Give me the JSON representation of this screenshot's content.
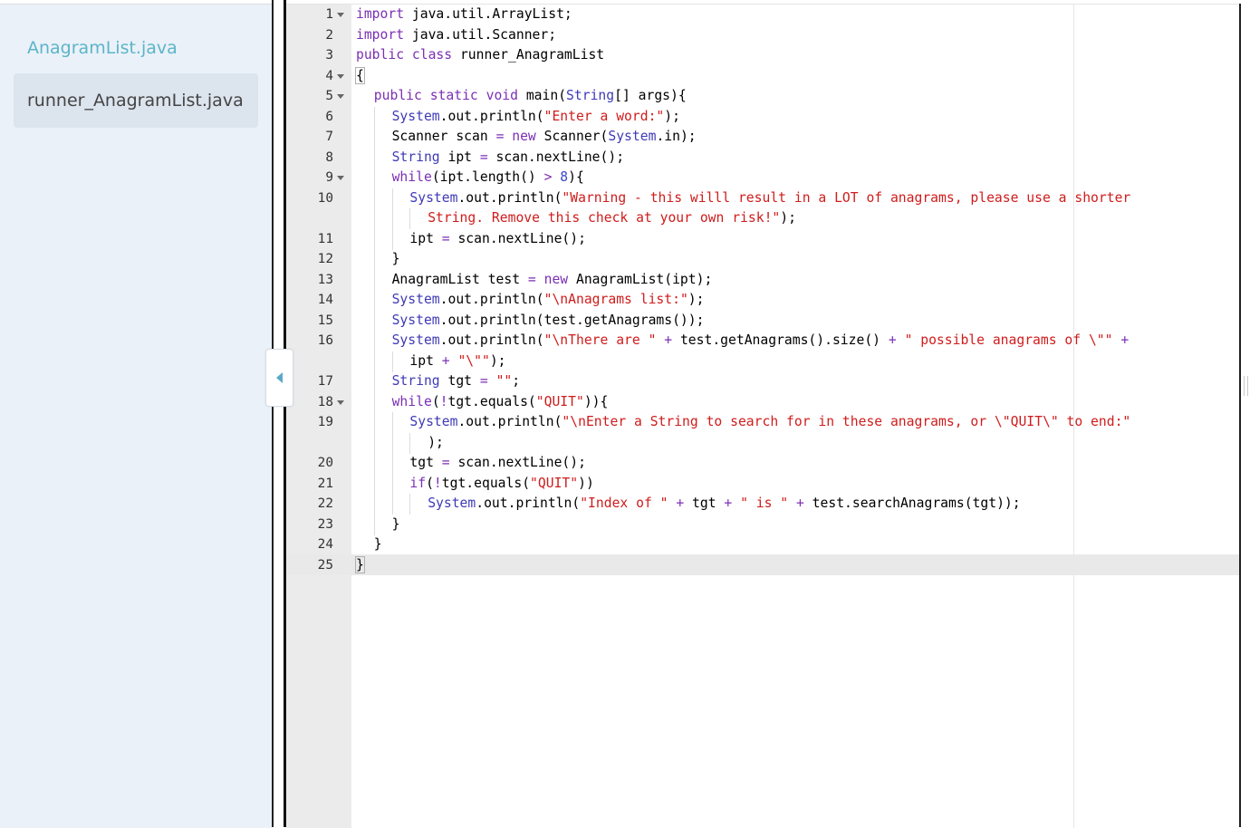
{
  "sidebar": {
    "files": [
      {
        "label": "AnagramList.java"
      },
      {
        "label": "runner_AnagramList.java"
      }
    ]
  },
  "editor": {
    "lines": [
      {
        "num": "1",
        "fold": true,
        "indent": 0,
        "parts": [
          [
            "k",
            "import"
          ],
          [
            "p",
            " java.util.ArrayList;"
          ]
        ]
      },
      {
        "num": "2",
        "indent": 0,
        "parts": [
          [
            "k",
            "import"
          ],
          [
            "p",
            " java.util.Scanner;"
          ]
        ]
      },
      {
        "num": "3",
        "indent": 0,
        "parts": [
          [
            "k",
            "public"
          ],
          [
            "p",
            " "
          ],
          [
            "k",
            "class"
          ],
          [
            "p",
            " runner_AnagramList"
          ]
        ]
      },
      {
        "num": "4",
        "fold": true,
        "indent": 0,
        "parts": [
          [
            "b",
            "{"
          ]
        ]
      },
      {
        "num": "5",
        "fold": true,
        "indent": 1,
        "parts": [
          [
            "k",
            "public"
          ],
          [
            "p",
            " "
          ],
          [
            "k",
            "static"
          ],
          [
            "p",
            " "
          ],
          [
            "k",
            "void"
          ],
          [
            "p",
            " main("
          ],
          [
            "t",
            "String"
          ],
          [
            "p",
            "[] args){"
          ]
        ]
      },
      {
        "num": "6",
        "indent": 2,
        "parts": [
          [
            "t",
            "System"
          ],
          [
            "p",
            ".out.println("
          ],
          [
            "s",
            "\"Enter a word:\""
          ],
          [
            "p",
            ");"
          ]
        ]
      },
      {
        "num": "7",
        "indent": 2,
        "parts": [
          [
            "p",
            "Scanner scan "
          ],
          [
            "k",
            "="
          ],
          [
            "p",
            " "
          ],
          [
            "k",
            "new"
          ],
          [
            "p",
            " Scanner("
          ],
          [
            "t",
            "System"
          ],
          [
            "p",
            ".in);"
          ]
        ]
      },
      {
        "num": "8",
        "indent": 2,
        "parts": [
          [
            "t",
            "String"
          ],
          [
            "p",
            " ipt "
          ],
          [
            "k",
            "="
          ],
          [
            "p",
            " scan.nextLine();"
          ]
        ]
      },
      {
        "num": "9",
        "fold": true,
        "indent": 2,
        "parts": [
          [
            "k",
            "while"
          ],
          [
            "p",
            "(ipt.length() "
          ],
          [
            "k",
            ">"
          ],
          [
            "p",
            " "
          ],
          [
            "n",
            "8"
          ],
          [
            "p",
            "){"
          ]
        ]
      },
      {
        "num": "10",
        "indent": 3,
        "parts": [
          [
            "t",
            "System"
          ],
          [
            "p",
            ".out.println("
          ],
          [
            "s",
            "\"Warning - this willl result in a LOT of anagrams, please use a shorter"
          ]
        ]
      },
      {
        "num": "",
        "indent": 4,
        "parts": [
          [
            "s",
            "String. Remove this check at your own risk!\""
          ],
          [
            "p",
            ");"
          ]
        ]
      },
      {
        "num": "11",
        "indent": 3,
        "parts": [
          [
            "p",
            "ipt "
          ],
          [
            "k",
            "="
          ],
          [
            "p",
            " scan.nextLine();"
          ]
        ]
      },
      {
        "num": "12",
        "indent": 2,
        "parts": [
          [
            "p",
            "}"
          ]
        ]
      },
      {
        "num": "13",
        "indent": 2,
        "parts": [
          [
            "p",
            "AnagramList test "
          ],
          [
            "k",
            "="
          ],
          [
            "p",
            " "
          ],
          [
            "k",
            "new"
          ],
          [
            "p",
            " AnagramList(ipt);"
          ]
        ]
      },
      {
        "num": "14",
        "indent": 2,
        "parts": [
          [
            "t",
            "System"
          ],
          [
            "p",
            ".out.println("
          ],
          [
            "s",
            "\"\\nAnagrams list:\""
          ],
          [
            "p",
            ");"
          ]
        ]
      },
      {
        "num": "15",
        "indent": 2,
        "parts": [
          [
            "t",
            "System"
          ],
          [
            "p",
            ".out.println(test.getAnagrams());"
          ]
        ]
      },
      {
        "num": "16",
        "indent": 2,
        "parts": [
          [
            "t",
            "System"
          ],
          [
            "p",
            ".out.println("
          ],
          [
            "s",
            "\"\\nThere are \""
          ],
          [
            "p",
            " "
          ],
          [
            "k",
            "+"
          ],
          [
            "p",
            " test.getAnagrams().size() "
          ],
          [
            "k",
            "+"
          ],
          [
            "p",
            " "
          ],
          [
            "s",
            "\" possible anagrams of \\\"\""
          ],
          [
            "p",
            " "
          ],
          [
            "k",
            "+"
          ]
        ]
      },
      {
        "num": "",
        "indent": 3,
        "parts": [
          [
            "p",
            "ipt "
          ],
          [
            "k",
            "+"
          ],
          [
            "p",
            " "
          ],
          [
            "s",
            "\"\\\"\""
          ],
          [
            "p",
            ");"
          ]
        ]
      },
      {
        "num": "17",
        "indent": 2,
        "parts": [
          [
            "t",
            "String"
          ],
          [
            "p",
            " tgt "
          ],
          [
            "k",
            "="
          ],
          [
            "p",
            " "
          ],
          [
            "s",
            "\"\""
          ],
          [
            "p",
            ";"
          ]
        ]
      },
      {
        "num": "18",
        "fold": true,
        "indent": 2,
        "parts": [
          [
            "k",
            "while"
          ],
          [
            "p",
            "("
          ],
          [
            "k",
            "!"
          ],
          [
            "p",
            "tgt.equals("
          ],
          [
            "s",
            "\"QUIT\""
          ],
          [
            "p",
            "))"
          ],
          [
            "p",
            "{"
          ]
        ]
      },
      {
        "num": "19",
        "indent": 3,
        "parts": [
          [
            "t",
            "System"
          ],
          [
            "p",
            ".out.println("
          ],
          [
            "s",
            "\"\\nEnter a String to search for in these anagrams, or \\\"QUIT\\\" to end:\""
          ]
        ]
      },
      {
        "num": "",
        "indent": 4,
        "parts": [
          [
            "p",
            ");"
          ]
        ]
      },
      {
        "num": "20",
        "indent": 3,
        "parts": [
          [
            "p",
            "tgt "
          ],
          [
            "k",
            "="
          ],
          [
            "p",
            " scan.nextLine();"
          ]
        ]
      },
      {
        "num": "21",
        "indent": 3,
        "parts": [
          [
            "k",
            "if"
          ],
          [
            "p",
            "("
          ],
          [
            "k",
            "!"
          ],
          [
            "p",
            "tgt.equals("
          ],
          [
            "s",
            "\"QUIT\""
          ],
          [
            "p",
            "))"
          ]
        ]
      },
      {
        "num": "22",
        "indent": 4,
        "parts": [
          [
            "t",
            "System"
          ],
          [
            "p",
            ".out.println("
          ],
          [
            "s",
            "\"Index of \""
          ],
          [
            "p",
            " "
          ],
          [
            "k",
            "+"
          ],
          [
            "p",
            " tgt "
          ],
          [
            "k",
            "+"
          ],
          [
            "p",
            " "
          ],
          [
            "s",
            "\" is \""
          ],
          [
            "p",
            " "
          ],
          [
            "k",
            "+"
          ],
          [
            "p",
            " test.searchAnagrams(tgt));"
          ]
        ]
      },
      {
        "num": "23",
        "indent": 2,
        "parts": [
          [
            "p",
            "}"
          ]
        ]
      },
      {
        "num": "24",
        "indent": 1,
        "parts": [
          [
            "p",
            "}"
          ]
        ]
      },
      {
        "num": "25",
        "indent": 0,
        "parts": [
          [
            "b",
            "}"
          ]
        ]
      }
    ]
  }
}
